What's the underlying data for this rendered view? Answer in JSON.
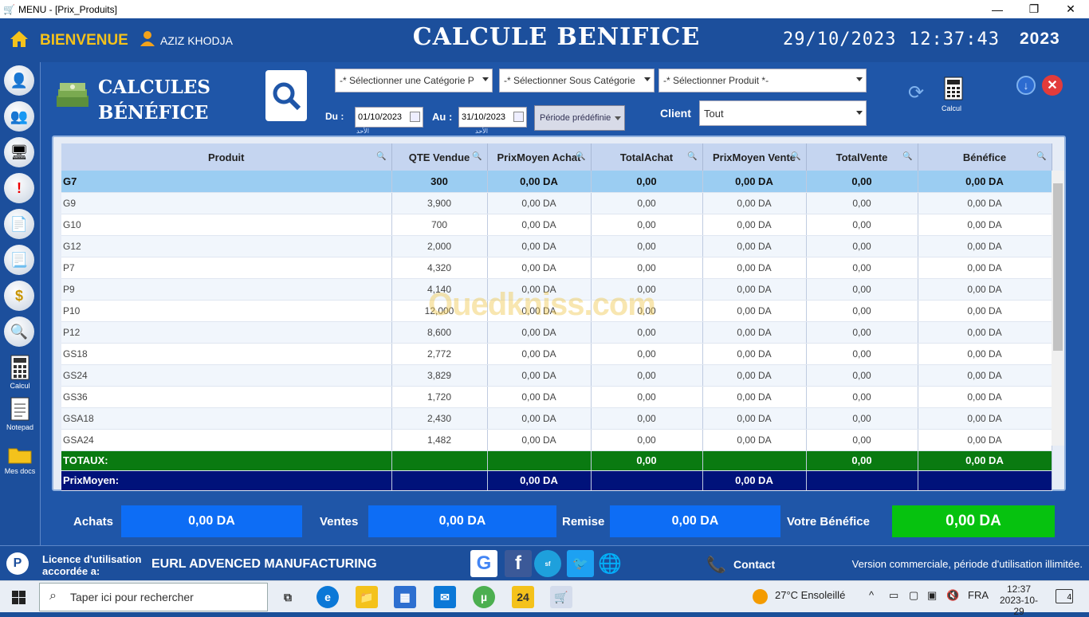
{
  "window": {
    "title": "MENU - [Prix_Produits]",
    "controls": [
      "—",
      "❐",
      "✕"
    ]
  },
  "header": {
    "welcome": "BIENVENUE",
    "user": "AZIZ KHODJA",
    "title": "CALCULE BENIFICE",
    "date": "29/10/2023",
    "time": "12:37:43",
    "year": "2023"
  },
  "sidebar": {
    "calc_label": "Calcul",
    "notepad_label": "Notepad",
    "docs_label": "Mes docs"
  },
  "panel": {
    "title_line1": "CALCULES",
    "title_line2": "BÉNÉFICE",
    "category_placeholder": "-* Sélectionner une Catégorie P",
    "subcategory_placeholder": "-* Sélectionner Sous Catégorie",
    "product_placeholder": "-* Sélectionner Produit *-",
    "du_label": "Du :",
    "du_value": "01/10/2023",
    "du_sub": "الأحد",
    "au_label": "Au :",
    "au_value": "31/10/2023",
    "au_sub": "الأحد",
    "periode_label": "Période prédéfinie",
    "client_label": "Client",
    "client_value": "Tout",
    "calc_label": "Calcul"
  },
  "table": {
    "columns": [
      "Produit",
      "QTE Vendue",
      "PrixMoyen Achat",
      "TotalAchat",
      "PrixMoyen Vente",
      "TotalVente",
      "Bénéfice"
    ],
    "rows": [
      [
        "G7",
        "300",
        "0,00 DA",
        "0,00",
        "0,00 DA",
        "0,00",
        "0,00 DA"
      ],
      [
        "G9",
        "3,900",
        "0,00 DA",
        "0,00",
        "0,00 DA",
        "0,00",
        "0,00 DA"
      ],
      [
        "G10",
        "700",
        "0,00 DA",
        "0,00",
        "0,00 DA",
        "0,00",
        "0,00 DA"
      ],
      [
        "G12",
        "2,000",
        "0,00 DA",
        "0,00",
        "0,00 DA",
        "0,00",
        "0,00 DA"
      ],
      [
        "P7",
        "4,320",
        "0,00 DA",
        "0,00",
        "0,00 DA",
        "0,00",
        "0,00 DA"
      ],
      [
        "P9",
        "4,140",
        "0,00 DA",
        "0,00",
        "0,00 DA",
        "0,00",
        "0,00 DA"
      ],
      [
        "P10",
        "12,000",
        "0,00 DA",
        "0,00",
        "0,00 DA",
        "0,00",
        "0,00 DA"
      ],
      [
        "P12",
        "8,600",
        "0,00 DA",
        "0,00",
        "0,00 DA",
        "0,00",
        "0,00 DA"
      ],
      [
        "GS18",
        "2,772",
        "0,00 DA",
        "0,00",
        "0,00 DA",
        "0,00",
        "0,00 DA"
      ],
      [
        "GS24",
        "3,829",
        "0,00 DA",
        "0,00",
        "0,00 DA",
        "0,00",
        "0,00 DA"
      ],
      [
        "GS36",
        "1,720",
        "0,00 DA",
        "0,00",
        "0,00 DA",
        "0,00",
        "0,00 DA"
      ],
      [
        "GSA18",
        "2,430",
        "0,00 DA",
        "0,00",
        "0,00 DA",
        "0,00",
        "0,00 DA"
      ],
      [
        "GSA24",
        "1,482",
        "0,00 DA",
        "0,00",
        "0,00 DA",
        "0,00",
        "0,00 DA"
      ]
    ],
    "totals": [
      "TOTAUX:",
      "",
      "",
      "0,00",
      "",
      "0,00",
      "0,00 DA"
    ],
    "averages": [
      "PrixMoyen:",
      "",
      "0,00 DA",
      "",
      "0,00 DA",
      "",
      ""
    ]
  },
  "watermark": "Ouedkniss.com",
  "summary": {
    "achats_label": "Achats",
    "achats_value": "0,00 DA",
    "ventes_label": "Ventes",
    "ventes_value": "0,00 DA",
    "remise_label": "Remise",
    "remise_value": "0,00 DA",
    "benefice_label": "Votre Bénéfice",
    "benefice_value": "0,00 DA"
  },
  "footer": {
    "licence_line1": "Licence d'utilisation",
    "licence_line2": "accordée a:",
    "company": "EURL ADVENCED MANUFACTURING",
    "contact": "Contact",
    "version": "Version commerciale, période d'utilisation illimitée."
  },
  "taskbar": {
    "search_placeholder": "Taper ici pour rechercher",
    "weather": "27°C  Ensoleillé",
    "lang": "FRA",
    "time": "12:37",
    "date": "2023-10-29",
    "notif_count": "4"
  }
}
